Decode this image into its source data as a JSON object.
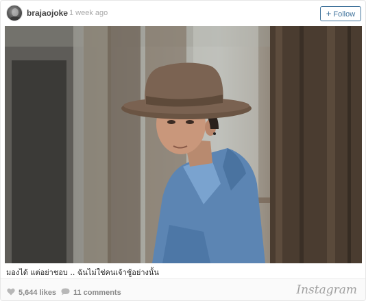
{
  "header": {
    "username": "brajaojoke",
    "separator": "•",
    "time_ago": "1 week ago",
    "follow_label": "Follow",
    "follow_plus": "+"
  },
  "photo": {
    "subject": "man in brown wide-brim hat and denim jacket beside wooden pillar"
  },
  "caption": "มองได้ แต่อย่าชอบ .. ฉันไม่ใช่คนเจ้าชู้อย่างนั้น",
  "footer": {
    "likes": "5,644 likes",
    "comments": "11 comments",
    "brand": "Instagram"
  },
  "colors": {
    "accent": "#3f729b",
    "text": "#262626",
    "muted": "#a8a8a8",
    "footer_bg": "#fafafa"
  },
  "icons": {
    "like": "heart-icon",
    "comment": "comment-bubble-icon"
  }
}
